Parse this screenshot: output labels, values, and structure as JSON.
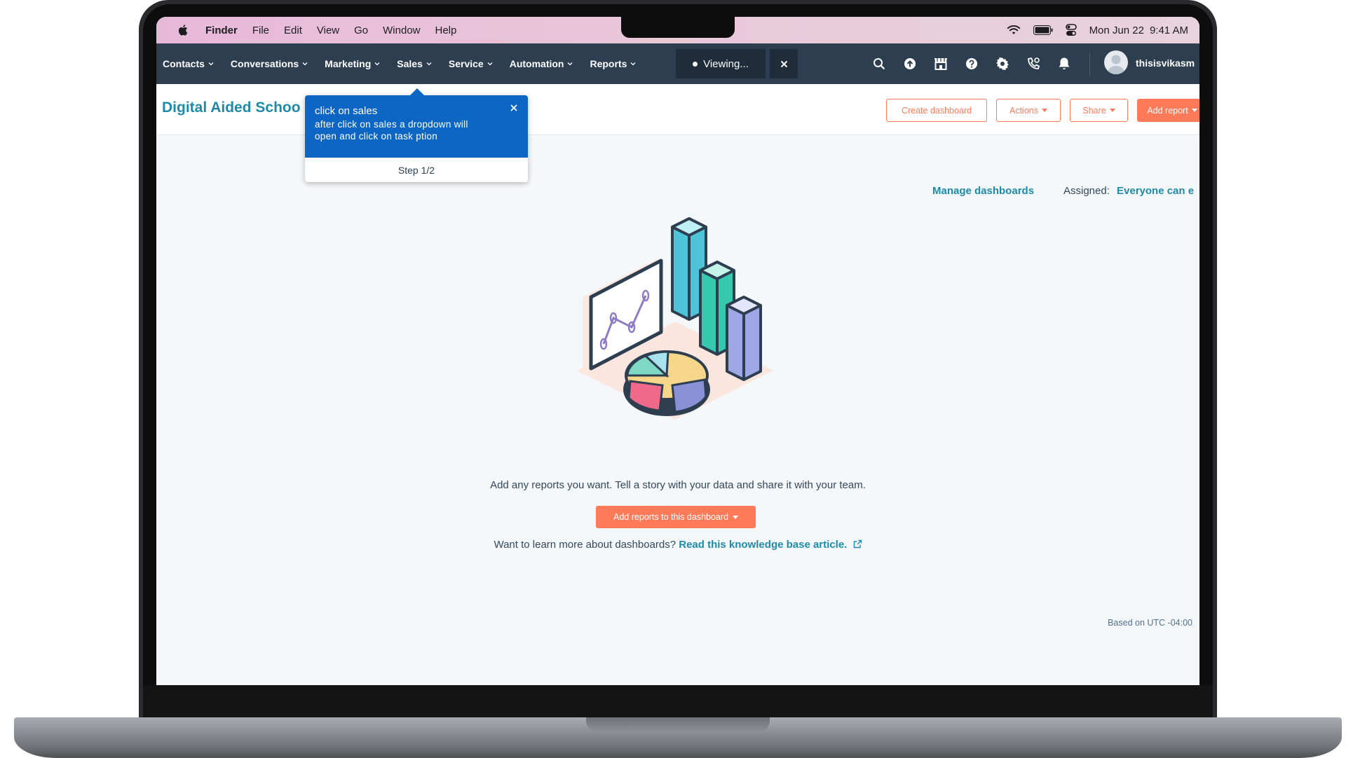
{
  "menubar": {
    "app_name": "Finder",
    "items": [
      "File",
      "Edit",
      "View",
      "Go",
      "Window",
      "Help"
    ],
    "date": "Mon Jun 22",
    "time": "9:41 AM",
    "icons": [
      "apple-icon",
      "wifi-icon",
      "battery-icon",
      "control-center-icon"
    ]
  },
  "nav": {
    "items": [
      {
        "label": "Contacts"
      },
      {
        "label": "Conversations"
      },
      {
        "label": "Marketing"
      },
      {
        "label": "Sales"
      },
      {
        "label": "Service"
      },
      {
        "label": "Automation"
      },
      {
        "label": "Reports"
      }
    ],
    "viewing_label": "Viewing...",
    "username": "thisisvikasm",
    "icons": [
      "search-icon",
      "upgrade-icon",
      "marketplace-icon",
      "help-icon",
      "settings-icon",
      "calling-icon",
      "notifications-icon"
    ]
  },
  "header": {
    "title": "Digital Aided Schoo",
    "create_dashboard": "Create dashboard",
    "actions": "Actions",
    "share": "Share",
    "add_report": "Add report"
  },
  "content": {
    "manage_dashboards": "Manage dashboards",
    "assigned_label": "Assigned:",
    "assigned_value": "Everyone can e",
    "empty_message": "Add any reports you want. Tell a story with your data and share it with your team.",
    "cta_label": "Add reports to this dashboard",
    "learn_prefix": "Want to learn more about dashboards?",
    "learn_link": "Read this knowledge base article.",
    "timezone": "Based on UTC -04:00"
  },
  "guide": {
    "title": "click on sales",
    "body_line1": "after click on sales a dropdown will",
    "body_line2": "open and click on task ption",
    "step": "Step 1/2"
  },
  "colors": {
    "nav_bg": "#2d3e50",
    "accent_orange": "#ff7a59",
    "link_teal": "#1f8aa8",
    "guide_blue": "#0e66c4",
    "content_bg": "#f5f8fa"
  }
}
